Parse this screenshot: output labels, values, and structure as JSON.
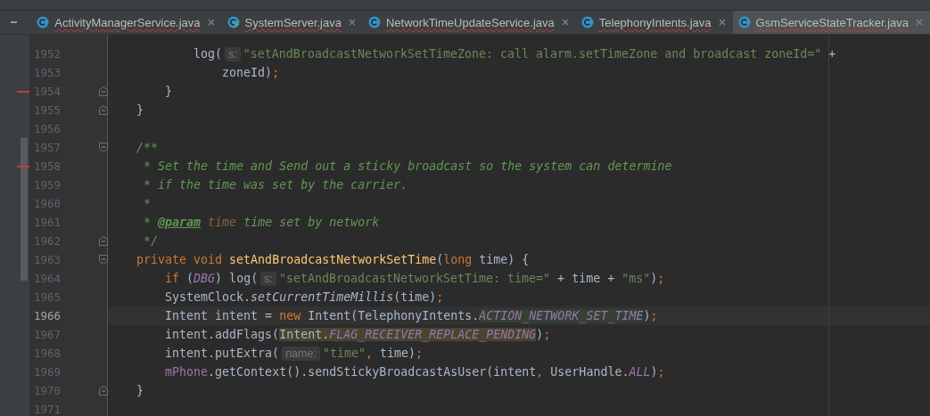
{
  "tabs": [
    {
      "label": "ActivityManagerService.java",
      "runnable": false,
      "selected": false
    },
    {
      "label": "SystemServer.java",
      "runnable": true,
      "selected": false
    },
    {
      "label": "NetworkTimeUpdateService.java",
      "runnable": false,
      "selected": false
    },
    {
      "label": "TelephonyIntents.java",
      "runnable": false,
      "selected": false
    },
    {
      "label": "GsmServiceStateTracker.java",
      "runnable": false,
      "selected": true
    }
  ],
  "editor": {
    "lines": [
      {
        "number": "1952",
        "kind": "plain",
        "current": false,
        "changed": false,
        "tokens": [
          {
            "kind": "plain",
            "text": "            log("
          },
          {
            "kind": "hint",
            "text": "s:"
          },
          {
            "kind": "str",
            "text": "\"setAndBroadcastNetworkSetTimeZone: call alarm.setTimeZone and broadcast zoneId=\""
          },
          {
            "kind": "plain",
            "text": " +"
          }
        ]
      },
      {
        "number": "1953",
        "kind": "plain",
        "current": false,
        "changed": false,
        "tokens": [
          {
            "kind": "plain",
            "text": "                zoneId)"
          },
          {
            "kind": "punct",
            "text": ";"
          }
        ]
      },
      {
        "number": "1954",
        "kind": "fold-close",
        "current": false,
        "changed": true,
        "tokens": [
          {
            "kind": "plain",
            "text": "        }"
          }
        ]
      },
      {
        "number": "1955",
        "kind": "fold-close",
        "current": false,
        "changed": false,
        "tokens": [
          {
            "kind": "plain",
            "text": "    }"
          }
        ]
      },
      {
        "number": "1956",
        "kind": "plain",
        "current": false,
        "changed": false
      },
      {
        "number": "1957",
        "kind": "fold-open",
        "current": false,
        "changed": false,
        "tokens": [
          {
            "kind": "comment",
            "text": "    /**"
          }
        ]
      },
      {
        "number": "1958",
        "kind": "plain",
        "current": false,
        "changed": true,
        "tokens": [
          {
            "kind": "comment",
            "text": "     * Set the time and Send out a sticky broadcast so the system can determine"
          }
        ]
      },
      {
        "number": "1959",
        "kind": "plain",
        "current": false,
        "changed": false,
        "tokens": [
          {
            "kind": "comment",
            "text": "     * if the time was set by the carrier."
          }
        ]
      },
      {
        "number": "1960",
        "kind": "plain",
        "current": false,
        "changed": false,
        "tokens": [
          {
            "kind": "comment",
            "text": "     *"
          }
        ]
      },
      {
        "number": "1961",
        "kind": "plain",
        "current": false,
        "changed": false,
        "tokens": [
          {
            "kind": "comment",
            "text": "     * "
          },
          {
            "kind": "doctag",
            "text": "@param"
          },
          {
            "kind": "param",
            "text": " time"
          },
          {
            "kind": "comment",
            "text": " time set by network"
          }
        ]
      },
      {
        "number": "1962",
        "kind": "fold-close",
        "current": false,
        "changed": false,
        "tokens": [
          {
            "kind": "comment",
            "text": "     */"
          }
        ]
      },
      {
        "number": "1963",
        "kind": "fold-open",
        "current": false,
        "changed": false,
        "tokens": [
          {
            "kind": "kw",
            "text": "    private void "
          },
          {
            "kind": "decl",
            "text": "setAndBroadcastNetworkSetTime"
          },
          {
            "kind": "plain",
            "text": "("
          },
          {
            "kind": "kw",
            "text": "long"
          },
          {
            "kind": "plain",
            "text": " time) {"
          }
        ]
      },
      {
        "number": "1964",
        "kind": "plain",
        "current": false,
        "changed": false,
        "tokens": [
          {
            "kind": "kw",
            "text": "        if"
          },
          {
            "kind": "plain",
            "text": " ("
          },
          {
            "kind": "const",
            "text": "DBG"
          },
          {
            "kind": "plain",
            "text": ") log("
          },
          {
            "kind": "hint",
            "text": "s:"
          },
          {
            "kind": "str",
            "text": "\"setAndBroadcastNetworkSetTime: time=\""
          },
          {
            "kind": "plain",
            "text": " + time + "
          },
          {
            "kind": "str",
            "text": "\"ms\""
          },
          {
            "kind": "plain",
            "text": ")"
          },
          {
            "kind": "punct",
            "text": ";"
          }
        ]
      },
      {
        "number": "1965",
        "kind": "plain",
        "current": false,
        "changed": false,
        "tokens": [
          {
            "kind": "plain",
            "text": "        SystemClock."
          },
          {
            "kind": "static",
            "text": "setCurrentTimeMillis"
          },
          {
            "kind": "plain",
            "text": "(time)"
          },
          {
            "kind": "punct",
            "text": ";"
          }
        ]
      },
      {
        "number": "1966",
        "kind": "plain",
        "current": true,
        "changed": false,
        "tokens": [
          {
            "kind": "plain",
            "text": "        Intent intent = "
          },
          {
            "kind": "kw",
            "text": "new"
          },
          {
            "kind": "plain",
            "text": " Intent(TelephonyIntents."
          },
          {
            "kind": "const-write",
            "text": "ACTION_NETWORK_SET_TIME"
          },
          {
            "kind": "plain",
            "text": ")"
          },
          {
            "kind": "punct",
            "text": ";"
          }
        ]
      },
      {
        "number": "1967",
        "kind": "plain",
        "current": false,
        "changed": false,
        "tokens": [
          {
            "kind": "plain",
            "text": "        intent.addFlags("
          },
          {
            "kind": "plain-read",
            "text": "Intent."
          },
          {
            "kind": "const-read",
            "text": "FLAG_RECEIVER_REPLACE_PENDING"
          },
          {
            "kind": "plain",
            "text": ")"
          },
          {
            "kind": "punct",
            "text": ";"
          }
        ]
      },
      {
        "number": "1968",
        "kind": "plain",
        "current": false,
        "changed": false,
        "tokens": [
          {
            "kind": "plain",
            "text": "        intent.putExtra("
          },
          {
            "kind": "hint",
            "text": "name:"
          },
          {
            "kind": "str",
            "text": "\"time\""
          },
          {
            "kind": "punct",
            "text": ","
          },
          {
            "kind": "plain",
            "text": " time)"
          },
          {
            "kind": "punct",
            "text": ";"
          }
        ]
      },
      {
        "number": "1969",
        "kind": "plain",
        "current": false,
        "changed": false,
        "tokens": [
          {
            "kind": "field",
            "text": "        mPhone"
          },
          {
            "kind": "plain",
            "text": ".getContext().sendStickyBroadcastAsUser(intent"
          },
          {
            "kind": "punct",
            "text": ","
          },
          {
            "kind": "plain",
            "text": " UserHandle."
          },
          {
            "kind": "const",
            "text": "ALL"
          },
          {
            "kind": "plain",
            "text": ")"
          },
          {
            "kind": "punct",
            "text": ";"
          }
        ]
      },
      {
        "number": "1970",
        "kind": "fold-close",
        "current": false,
        "changed": false,
        "tokens": [
          {
            "kind": "plain",
            "text": "    }"
          }
        ]
      },
      {
        "number": "1971",
        "kind": "plain",
        "current": false,
        "changed": false
      }
    ]
  }
}
